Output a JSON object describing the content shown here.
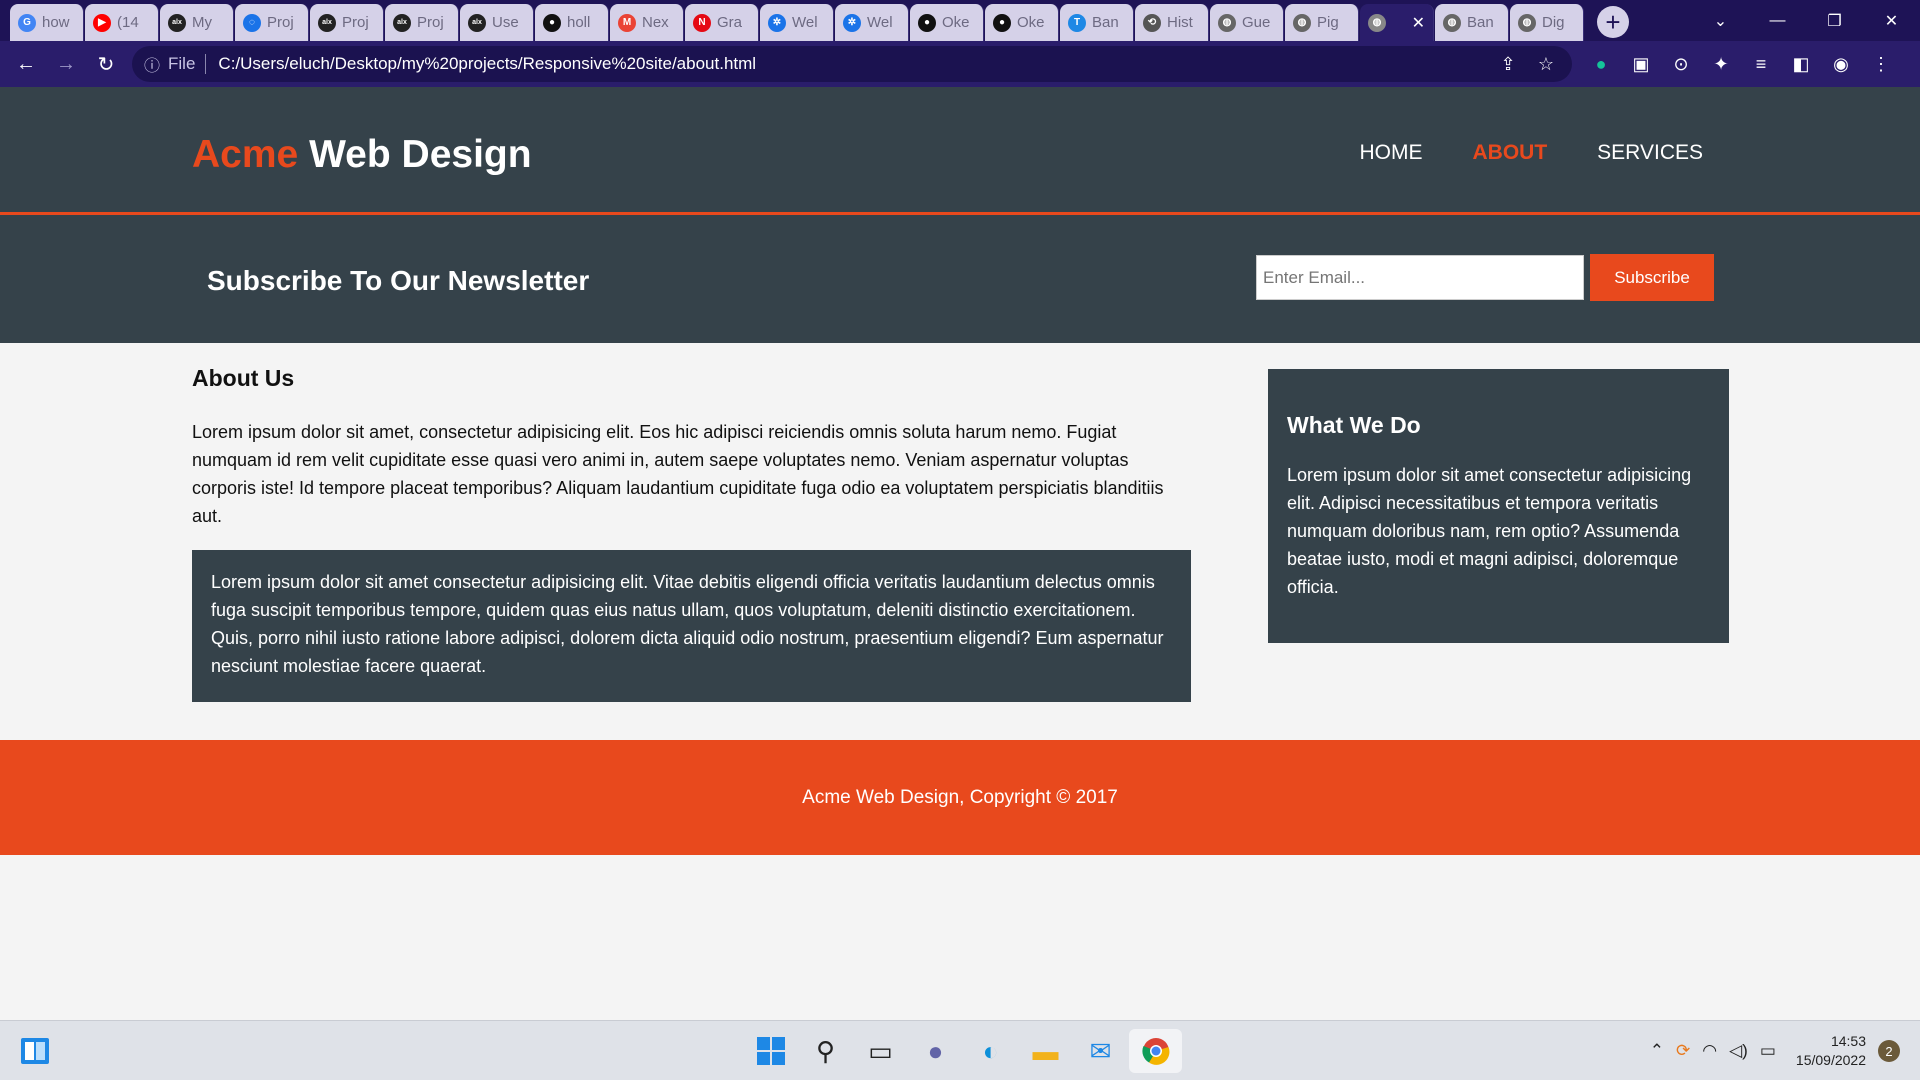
{
  "browser": {
    "tabs": [
      {
        "icon": "google-icon",
        "glyph": "G",
        "color": "#4285f4",
        "title": "how"
      },
      {
        "icon": "youtube-icon",
        "glyph": "▶",
        "color": "#ff0000",
        "title": "(14"
      },
      {
        "icon": "alx-icon",
        "glyph": "alx",
        "color": "#222222",
        "title": "My"
      },
      {
        "icon": "loading-icon",
        "glyph": "◌",
        "color": "#1a73e8",
        "title": "Proj"
      },
      {
        "icon": "alx-icon",
        "glyph": "alx",
        "color": "#222222",
        "title": "Proj"
      },
      {
        "icon": "alx-icon",
        "glyph": "alx",
        "color": "#222222",
        "title": "Proj"
      },
      {
        "icon": "alx-icon",
        "glyph": "alx",
        "color": "#222222",
        "title": "Use"
      },
      {
        "icon": "github-icon",
        "glyph": "●",
        "color": "#111111",
        "title": "holl"
      },
      {
        "icon": "gmail-icon",
        "glyph": "M",
        "color": "#ea4335",
        "title": "Nex"
      },
      {
        "icon": "netflix-icon",
        "glyph": "N",
        "color": "#e50914",
        "title": "Gra"
      },
      {
        "icon": "gear-icon",
        "glyph": "✲",
        "color": "#1a73e8",
        "title": "Wel"
      },
      {
        "icon": "gear-icon",
        "glyph": "✲",
        "color": "#1a73e8",
        "title": "Wel"
      },
      {
        "icon": "github-icon",
        "glyph": "●",
        "color": "#111111",
        "title": "Oke"
      },
      {
        "icon": "github-icon",
        "glyph": "●",
        "color": "#111111",
        "title": "Oke"
      },
      {
        "icon": "bank-icon",
        "glyph": "T",
        "color": "#1e88e5",
        "title": "Ban"
      },
      {
        "icon": "history-icon",
        "glyph": "⟲",
        "color": "#555555",
        "title": "Hist"
      },
      {
        "icon": "globe-icon",
        "glyph": "◍",
        "color": "#666666",
        "title": "Gue"
      },
      {
        "icon": "globe-icon",
        "glyph": "◍",
        "color": "#666666",
        "title": "Pig"
      },
      {
        "icon": "globe-icon",
        "glyph": "◍",
        "color": "#888888",
        "title": "",
        "active": true
      },
      {
        "icon": "globe-icon",
        "glyph": "◍",
        "color": "#666666",
        "title": "Ban"
      },
      {
        "icon": "globe-icon",
        "glyph": "◍",
        "color": "#666666",
        "title": "Dig"
      }
    ],
    "file_label": "File",
    "url": "C:/Users/eluch/Desktop/my%20projects/Responsive%20site/about.html"
  },
  "site": {
    "brand_highlight": "Acme",
    "brand_rest": " Web Design",
    "nav": [
      {
        "label": "Home",
        "current": false
      },
      {
        "label": "About",
        "current": true
      },
      {
        "label": "Services",
        "current": false
      }
    ],
    "newsletter": {
      "title": "Subscribe To Our Newsletter",
      "placeholder": "Enter Email...",
      "button": "Subscribe"
    },
    "main": {
      "heading": "About Us",
      "intro": "Lorem ipsum dolor sit amet, consectetur adipisicing elit. Eos hic adipisci reiciendis omnis soluta harum nemo. Fugiat numquam id rem velit cupiditate esse quasi vero animi in, autem saepe voluptates nemo. Veniam aspernatur voluptas corporis iste! Id tempore placeat temporibus? Aliquam laudantium cupiditate fuga odio ea voluptatem perspiciatis blanditiis aut.",
      "dark_box": "Lorem ipsum dolor sit amet consectetur adipisicing elit. Vitae debitis eligendi officia veritatis laudantium delectus omnis fuga suscipit temporibus tempore, quidem quas eius natus ullam, quos voluptatum, deleniti distinctio exercitationem. Quis, porro nihil iusto ratione labore adipisci, dolorem dicta aliquid odio nostrum, praesentium eligendi? Eum aspernatur nesciunt molestiae facere quaerat."
    },
    "sidebar": {
      "heading": "What We Do",
      "text": "Lorem ipsum dolor sit amet consectetur adipisicing elit. Adipisci necessitatibus et tempora veritatis numquam doloribus nam, rem optio? Assumenda beatae iusto, modi et magni adipisci, doloremque officia."
    },
    "footer": "Acme Web Design, Copyright © 2017",
    "colors": {
      "accent": "#e8491d",
      "dark": "#35424a",
      "background": "#f4f4f4"
    }
  },
  "taskbar": {
    "time": "14:53",
    "date": "15/09/2022",
    "notification_count": "2"
  }
}
